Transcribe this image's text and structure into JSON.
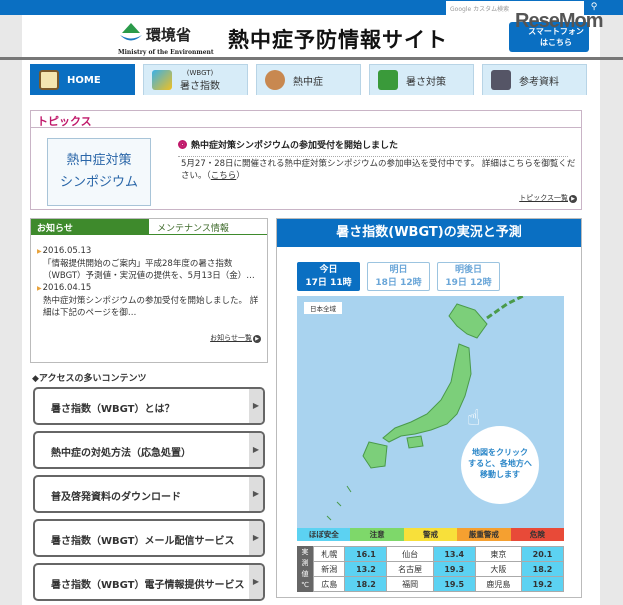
{
  "search": {
    "placeholder": "Google カスタム検索"
  },
  "header": {
    "ministry_jp": "環境省",
    "ministry_en": "Ministry of the Environment",
    "title": "熱中症予防情報サイト",
    "smartphone": "スマートフォン\nはこちら",
    "watermark": "ReseMom"
  },
  "nav": [
    {
      "label": "HOME",
      "icon": "house-icon"
    },
    {
      "sub": "(WBGT)",
      "label": "暑さ指数",
      "icon": "japan-map-icon"
    },
    {
      "label": "熱中症",
      "icon": "person-icon"
    },
    {
      "label": "暑さ対策",
      "icon": "green-curtain-icon"
    },
    {
      "label": "参考資料",
      "icon": "document-icon"
    }
  ],
  "topics": {
    "heading": "トピックス",
    "image_text": [
      "熱中症対策",
      "シンポジウム"
    ],
    "title": "熱中症対策シンポジウムの参加受付を開始しました",
    "body": "5月27・28日に開催される熱中症対策シンポジウムの参加申込を受付中です。 詳細はこちらを御覧ください。（",
    "link": "こちら",
    "body_end": "）",
    "more": "トピックス一覧"
  },
  "news": {
    "tab_active": "お知らせ",
    "tab_other": "メンテナンス情報",
    "items": [
      {
        "date": "2016.05.13",
        "text": "「情報提供開始のご案内」平成28年度の暑さ指数（WBGT）予測値・実況値の提供を、5月13日（金）…"
      },
      {
        "date": "2016.04.15",
        "text": "熱中症対策シンポジウムの参加受付を開始しました。 詳細は下記のページを御…"
      }
    ],
    "more": "お知らせ一覧"
  },
  "access": {
    "heading": "◆アクセスの多いコンテンツ",
    "items": [
      "暑さ指数（WBGT）とは？",
      "熱中症の対処方法（応急処置）",
      "普及啓発資料のダウンロード",
      "暑さ指数（WBGT）メール配信サービス",
      "暑さ指数（WBGT）電子情報提供サービス"
    ]
  },
  "wbgt": {
    "title": "暑さ指数(WBGT)の実況と予測",
    "days": [
      {
        "label": "今日",
        "time": "17日 11時",
        "active": true
      },
      {
        "label": "明日",
        "time": "18日 12時"
      },
      {
        "label": "明後日",
        "time": "19日 12時"
      }
    ],
    "map_label": "日本全域",
    "bubble": [
      "地図をクリック",
      "すると、各地方へ",
      "移動します"
    ],
    "legend": [
      {
        "label": "ほぼ安全",
        "color": "#5cd2f2"
      },
      {
        "label": "注意",
        "color": "#7ed86a"
      },
      {
        "label": "警戒",
        "color": "#f8e03a"
      },
      {
        "label": "厳重警戒",
        "color": "#f5a030"
      },
      {
        "label": "危険",
        "color": "#e84a38"
      }
    ],
    "obs_label": [
      "実",
      "測",
      "値",
      "℃"
    ],
    "observations": [
      [
        {
          "city": "札幌",
          "value": "16.1"
        },
        {
          "city": "仙台",
          "value": "13.4"
        },
        {
          "city": "東京",
          "value": "20.1"
        }
      ],
      [
        {
          "city": "新潟",
          "value": "13.2"
        },
        {
          "city": "名古屋",
          "value": "19.3"
        },
        {
          "city": "大阪",
          "value": "18.2"
        }
      ],
      [
        {
          "city": "広島",
          "value": "18.2"
        },
        {
          "city": "福岡",
          "value": "19.5"
        },
        {
          "city": "鹿児島",
          "value": "19.2"
        }
      ]
    ]
  }
}
